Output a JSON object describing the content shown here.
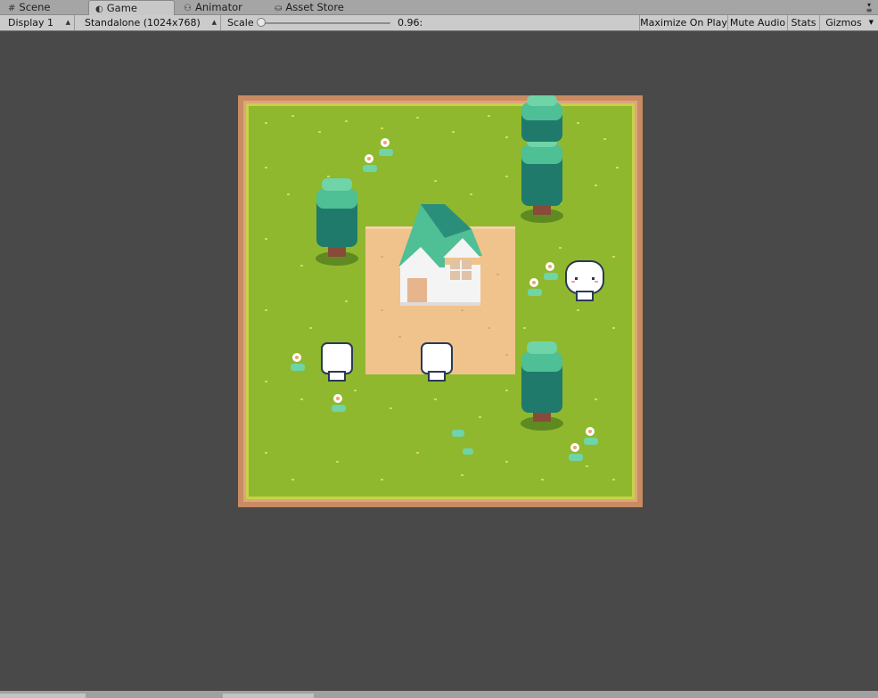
{
  "tabs": [
    {
      "label": "Scene",
      "icon": "scene-grid-icon"
    },
    {
      "label": "Game",
      "icon": "game-pacman-icon",
      "active": true
    },
    {
      "label": "Animator",
      "icon": "animator-icon"
    },
    {
      "label": "Asset Store",
      "icon": "asset-store-icon"
    }
  ],
  "toolbar": {
    "display": "Display 1",
    "resolution": "Standalone (1024x768)",
    "scale_label": "Scale",
    "scale_value": "0.96:",
    "scale_fraction": 0.0,
    "maximize": "Maximize On Play",
    "mute": "Mute Audio",
    "stats": "Stats",
    "gizmos": "Gizmos"
  },
  "scene": {
    "colors": {
      "background": "#494949",
      "border": "#c98b63",
      "grass": "#8fb82e",
      "grass_edge": "#c7d24a",
      "dirt": "#f0c38d",
      "tree_dark": "#1f7a6c",
      "tree_light": "#4fbf95",
      "roof": "#2a8f7a",
      "wall": "#f4f4f4",
      "ghost": "#ffffff"
    },
    "objects": [
      "house",
      "tree",
      "tree",
      "tree",
      "tree",
      "ghost",
      "ghost",
      "long-eared-ghost",
      "flower",
      "shrub"
    ]
  }
}
